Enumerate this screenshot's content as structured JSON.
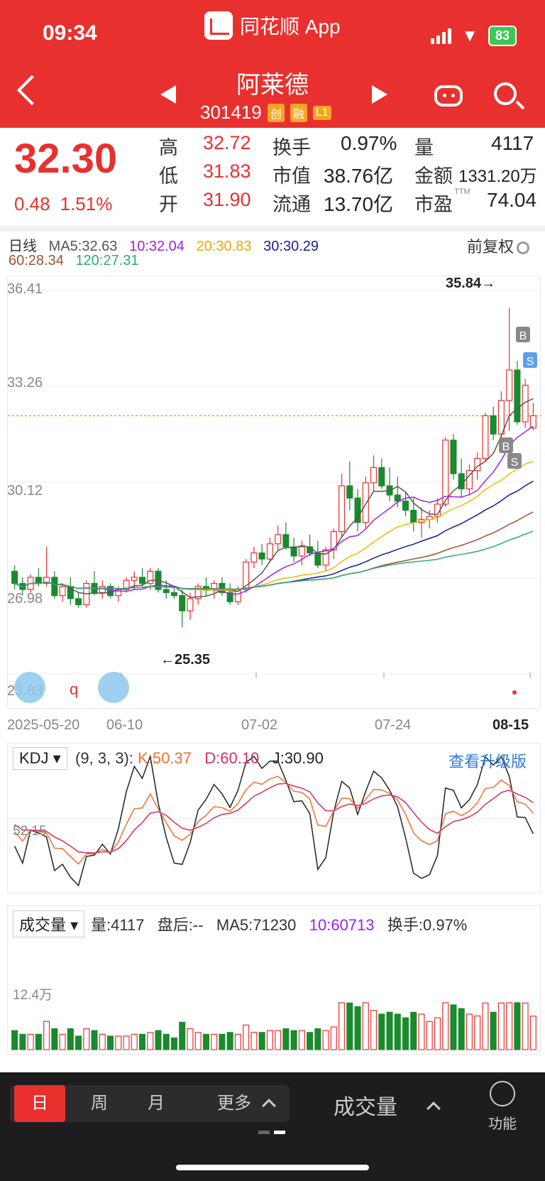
{
  "status": {
    "time": "09:34",
    "battery": "83"
  },
  "app": {
    "title": "同花顺 App"
  },
  "stock": {
    "name": "阿莱德",
    "code": "301419",
    "tags": [
      "创",
      "融",
      "L1"
    ]
  },
  "quote": {
    "price": "32.30",
    "change": "0.48",
    "change_pct": "1.51%",
    "high_label": "高",
    "high": "32.72",
    "low_label": "低",
    "low": "31.83",
    "open_label": "开",
    "open": "31.90",
    "turnover_label": "换手",
    "turnover": "0.97%",
    "mktcap_label": "市值",
    "mktcap": "38.76亿",
    "float_label": "流通",
    "float": "13.70亿",
    "vol_label": "量",
    "vol": "4117",
    "amount_label": "金额",
    "amount": "1331.20万",
    "pe_label": "市盈",
    "pe_sup": "TTM",
    "pe": "74.04"
  },
  "ma": {
    "period": "日线",
    "ma5": "MA5:32.63",
    "ma10": "10:32.04",
    "ma20": "20:30.83",
    "ma30": "30:30.29",
    "ma60": "60:28.34",
    "ma120": "120:27.31",
    "adjust": "前复权"
  },
  "colors": {
    "up": "#e8312f",
    "down": "#1a8a2e",
    "ma5": "#555555",
    "ma10": "#a020f0",
    "ma20": "#f5b800",
    "ma30": "#1a1a99",
    "ma60": "#a0522d",
    "ma120": "#2eaa77"
  },
  "chart_data": {
    "type": "candlestick",
    "y_ticks": [
      "36.41",
      "33.26",
      "30.12",
      "26.98",
      "23.83"
    ],
    "ylim": [
      23.83,
      36.41
    ],
    "x_ticks": [
      "2025-05-20",
      "06-10",
      "07-02",
      "07-24",
      "08-15"
    ],
    "high_mark": "35.84",
    "low_mark": "25.35",
    "last_price": 32.3,
    "candles": [
      [
        27.2,
        27.4,
        26.6,
        26.8
      ],
      [
        26.8,
        27.0,
        26.4,
        26.6
      ],
      [
        26.6,
        27.1,
        26.5,
        27.0
      ],
      [
        27.0,
        27.3,
        26.7,
        26.8
      ],
      [
        26.8,
        28.0,
        26.7,
        27.0
      ],
      [
        27.0,
        27.2,
        26.3,
        26.4
      ],
      [
        26.4,
        26.8,
        26.2,
        26.7
      ],
      [
        26.7,
        27.0,
        26.1,
        26.3
      ],
      [
        26.3,
        26.5,
        26.0,
        26.1
      ],
      [
        26.1,
        26.9,
        26.0,
        26.8
      ],
      [
        26.8,
        27.2,
        26.4,
        26.5
      ],
      [
        26.5,
        26.9,
        26.3,
        26.7
      ],
      [
        26.7,
        26.8,
        26.3,
        26.4
      ],
      [
        26.4,
        26.7,
        26.2,
        26.6
      ],
      [
        26.6,
        27.0,
        26.5,
        26.9
      ],
      [
        26.9,
        27.2,
        26.6,
        27.0
      ],
      [
        27.0,
        27.3,
        26.7,
        26.8
      ],
      [
        26.8,
        27.3,
        26.6,
        27.2
      ],
      [
        27.2,
        27.3,
        26.5,
        26.6
      ],
      [
        26.6,
        26.9,
        26.3,
        26.5
      ],
      [
        26.5,
        26.7,
        26.3,
        26.4
      ],
      [
        26.4,
        26.6,
        25.35,
        25.9
      ],
      [
        25.9,
        26.5,
        25.6,
        26.3
      ],
      [
        26.3,
        26.8,
        26.1,
        26.7
      ],
      [
        26.7,
        27.0,
        26.4,
        26.6
      ],
      [
        26.6,
        26.9,
        26.3,
        26.8
      ],
      [
        26.8,
        27.0,
        26.4,
        26.5
      ],
      [
        26.5,
        26.8,
        26.1,
        26.2
      ],
      [
        26.2,
        26.7,
        26.1,
        26.6
      ],
      [
        26.6,
        27.6,
        26.5,
        27.5
      ],
      [
        27.5,
        28.0,
        27.3,
        27.8
      ],
      [
        27.8,
        28.1,
        27.4,
        27.6
      ],
      [
        27.6,
        28.3,
        27.5,
        28.1
      ],
      [
        28.1,
        28.7,
        27.9,
        28.4
      ],
      [
        28.4,
        28.8,
        27.9,
        28.0
      ],
      [
        28.0,
        28.3,
        27.5,
        27.7
      ],
      [
        27.7,
        28.2,
        27.4,
        28.0
      ],
      [
        28.0,
        28.4,
        27.7,
        27.8
      ],
      [
        27.8,
        28.2,
        27.3,
        27.4
      ],
      [
        27.4,
        28.0,
        27.2,
        27.9
      ],
      [
        27.9,
        28.6,
        27.6,
        28.5
      ],
      [
        28.5,
        30.4,
        28.3,
        30.0
      ],
      [
        30.0,
        30.8,
        29.2,
        29.6
      ],
      [
        29.6,
        29.9,
        28.5,
        28.8
      ],
      [
        28.8,
        30.3,
        28.6,
        30.1
      ],
      [
        30.1,
        31.0,
        29.8,
        30.6
      ],
      [
        30.6,
        30.9,
        29.9,
        30.0
      ],
      [
        30.0,
        30.6,
        29.5,
        29.7
      ],
      [
        29.7,
        30.3,
        29.3,
        29.5
      ],
      [
        29.5,
        29.8,
        29.0,
        29.2
      ],
      [
        29.2,
        29.6,
        28.5,
        28.8
      ],
      [
        28.8,
        29.3,
        28.3,
        28.9
      ],
      [
        28.9,
        29.2,
        28.6,
        29.0
      ],
      [
        29.0,
        29.6,
        28.8,
        29.4
      ],
      [
        29.4,
        31.6,
        29.3,
        31.5
      ],
      [
        31.5,
        31.7,
        30.2,
        30.4
      ],
      [
        30.4,
        30.9,
        29.6,
        29.9
      ],
      [
        29.9,
        30.7,
        29.7,
        30.5
      ],
      [
        30.5,
        31.1,
        30.2,
        30.9
      ],
      [
        30.9,
        32.4,
        30.8,
        32.3
      ],
      [
        32.3,
        32.6,
        31.5,
        31.7
      ],
      [
        31.7,
        33.1,
        31.5,
        32.8
      ],
      [
        32.8,
        35.84,
        31.8,
        33.8
      ],
      [
        33.8,
        34.1,
        32.0,
        32.1
      ],
      [
        32.1,
        33.5,
        31.9,
        33.3
      ],
      [
        31.9,
        32.72,
        31.83,
        32.3
      ]
    ],
    "kdj": {
      "params": "(9, 3, 3):",
      "K": "K:50.37",
      "D": "D:60.10",
      "J": "J:30.90",
      "level": "52.15"
    },
    "volume": {
      "vol": "量:4117",
      "after": "盘后:--",
      "ma5": "MA5:71230",
      "ma10": "10:60713",
      "turnover": "换手:0.97%",
      "level": "12.4万"
    }
  },
  "kdj_select": "KDJ",
  "upgrade": "查看升级版",
  "vol_select": "成交量",
  "markers": {
    "b": "B",
    "s": "S"
  },
  "bottom": {
    "tabs": [
      "日",
      "周",
      "月",
      "更多"
    ],
    "indicator": "成交量",
    "func": "功能"
  }
}
